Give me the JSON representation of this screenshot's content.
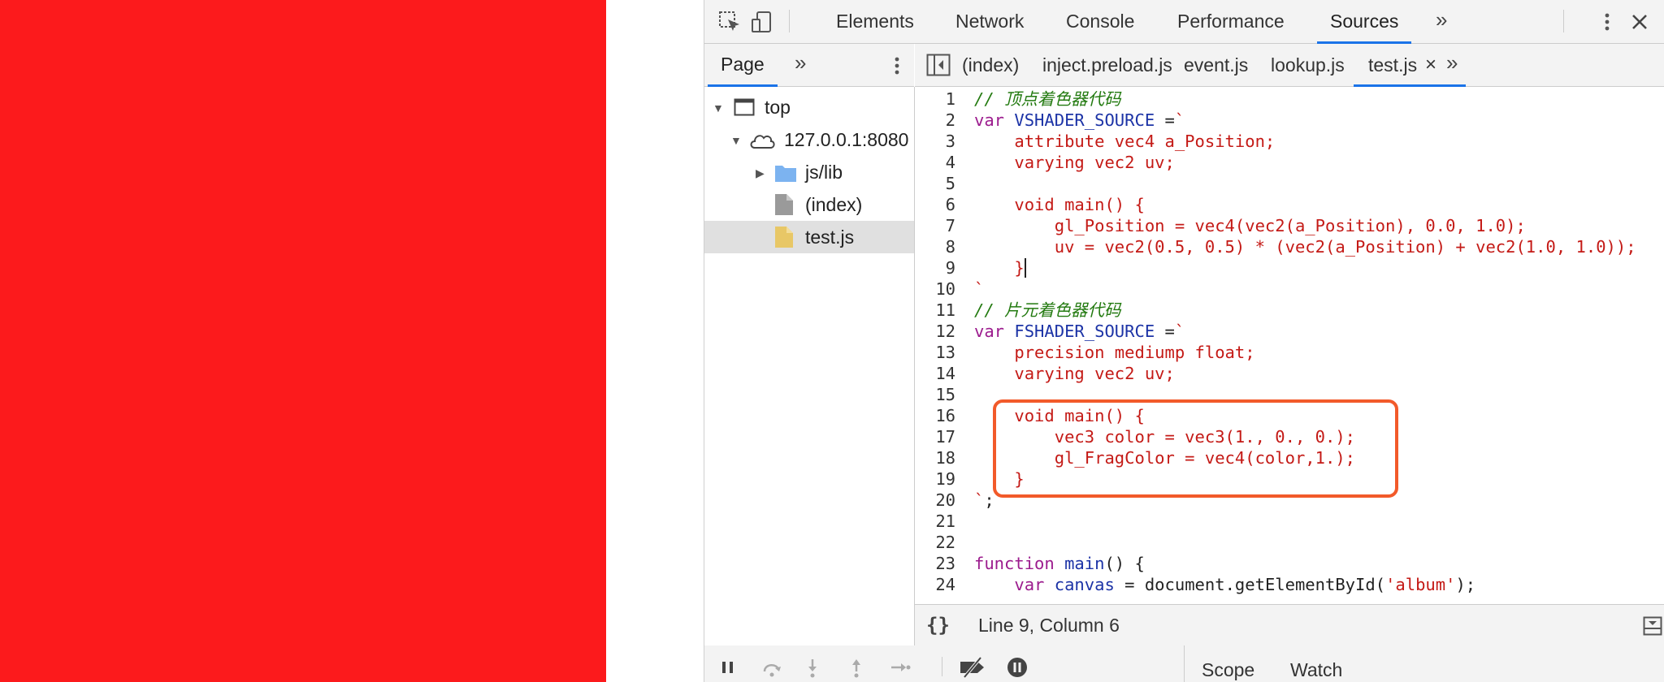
{
  "toolbar": {
    "tabs": [
      "Elements",
      "Network",
      "Console",
      "Performance",
      "Sources"
    ],
    "active_tab": "Sources",
    "more_tabs_label": "»",
    "kebab_icon": "vertical-dots-icon",
    "close_icon": "close-icon",
    "inspect_icon": "inspect-element-icon",
    "device_icon": "device-toolbar-icon"
  },
  "navigator": {
    "tab_label": "Page",
    "more_label": "»",
    "tree": [
      {
        "label": "top",
        "icon": "frame-icon"
      },
      {
        "label": "127.0.0.1:8080",
        "icon": "cloud-icon"
      },
      {
        "label": "js/lib",
        "icon": "folder-icon"
      },
      {
        "label": "(index)",
        "icon": "file-icon"
      },
      {
        "label": "test.js",
        "icon": "js-file-icon"
      }
    ]
  },
  "editor": {
    "tabs": [
      "(index)",
      "inject.preload.js",
      "event.js",
      "lookup.js",
      "test.js"
    ],
    "active_tab": "test.js",
    "tab_close": "×",
    "more_label": "»",
    "lines": [
      {
        "n": "1",
        "tokens": [
          [
            "c",
            "// 顶点着色器代码"
          ]
        ]
      },
      {
        "n": "2",
        "tokens": [
          [
            "k",
            "var "
          ],
          [
            "d",
            "VSHADER_SOURCE"
          ],
          [
            "p",
            " ="
          ],
          [
            "s",
            "`"
          ]
        ]
      },
      {
        "n": "3",
        "tokens": [
          [
            "s",
            "    attribute vec4 a_Position;"
          ]
        ]
      },
      {
        "n": "4",
        "tokens": [
          [
            "s",
            "    varying vec2 uv;"
          ]
        ]
      },
      {
        "n": "5",
        "tokens": [
          [
            "s",
            ""
          ]
        ]
      },
      {
        "n": "6",
        "tokens": [
          [
            "s",
            "    void main() {"
          ]
        ]
      },
      {
        "n": "7",
        "tokens": [
          [
            "s",
            "        gl_Position = vec4(vec2(a_Position), 0.0, 1.0);"
          ]
        ]
      },
      {
        "n": "8",
        "tokens": [
          [
            "s",
            "        uv = vec2(0.5, 0.5) * (vec2(a_Position) + vec2(1.0, 1.0));"
          ]
        ]
      },
      {
        "n": "9",
        "tokens": [
          [
            "s",
            "    }"
          ]
        ]
      },
      {
        "n": "10",
        "tokens": [
          [
            "s",
            "`"
          ]
        ]
      },
      {
        "n": "11",
        "tokens": [
          [
            "c",
            "// 片元着色器代码"
          ]
        ]
      },
      {
        "n": "12",
        "tokens": [
          [
            "k",
            "var "
          ],
          [
            "d",
            "FSHADER_SOURCE"
          ],
          [
            "p",
            " ="
          ],
          [
            "s",
            "`"
          ]
        ]
      },
      {
        "n": "13",
        "tokens": [
          [
            "s",
            "    precision mediump float;"
          ]
        ]
      },
      {
        "n": "14",
        "tokens": [
          [
            "s",
            "    varying vec2 uv;"
          ]
        ]
      },
      {
        "n": "15",
        "tokens": [
          [
            "s",
            ""
          ]
        ]
      },
      {
        "n": "16",
        "tokens": [
          [
            "s",
            "    void main() {"
          ]
        ]
      },
      {
        "n": "17",
        "tokens": [
          [
            "s",
            "        vec3 color = vec3(1., 0., 0.);"
          ]
        ]
      },
      {
        "n": "18",
        "tokens": [
          [
            "s",
            "        gl_FragColor = vec4(color,1.);"
          ]
        ]
      },
      {
        "n": "19",
        "tokens": [
          [
            "s",
            "    }"
          ]
        ]
      },
      {
        "n": "20",
        "tokens": [
          [
            "s",
            "`"
          ],
          [
            "p",
            ";"
          ]
        ]
      },
      {
        "n": "21",
        "tokens": [
          [
            "p",
            ""
          ]
        ]
      },
      {
        "n": "22",
        "tokens": [
          [
            "p",
            ""
          ]
        ]
      },
      {
        "n": "23",
        "tokens": [
          [
            "k",
            "function "
          ],
          [
            "d",
            "main"
          ],
          [
            "p",
            "() {"
          ]
        ]
      },
      {
        "n": "24",
        "tokens": [
          [
            "p",
            "    "
          ],
          [
            "k",
            "var "
          ],
          [
            "d",
            "canvas"
          ],
          [
            "p",
            " = document.getElementById("
          ],
          [
            "s",
            "'album'"
          ],
          [
            "p",
            ");"
          ]
        ]
      }
    ]
  },
  "status": {
    "format_label": "{}",
    "position": "Line 9, Column 6"
  },
  "debugger": {
    "sidebar_tabs": [
      "Scope",
      "Watch"
    ]
  },
  "colors": {
    "canvas_fill": "#fc1a1c",
    "accent": "#1a73e8",
    "highlight": "#f25a2a"
  }
}
